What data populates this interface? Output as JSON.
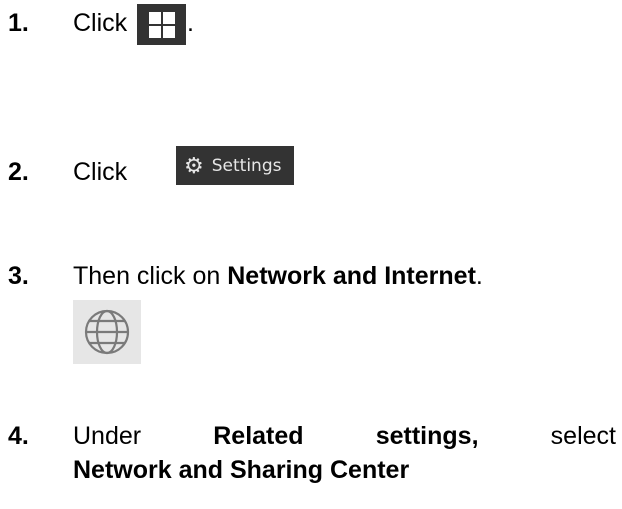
{
  "steps": [
    {
      "number": "1.",
      "prefix": "Click",
      "suffix": ".",
      "icon": "windows-start-icon"
    },
    {
      "number": "2.",
      "prefix": "Click",
      "button_label": "Settings",
      "icon": "gear-icon"
    },
    {
      "number": "3.",
      "prefix": "Then click on",
      "bold": "Network and Internet",
      "suffix": ".",
      "icon": "globe-icon"
    },
    {
      "number": "4.",
      "w1": "Under",
      "w2": "Related",
      "w3": "settings,",
      "w4": "select",
      "bold2": "Network and Sharing Center"
    }
  ],
  "colors": {
    "button_bg": "#333333",
    "tile_bg": "#e6e6e6",
    "icon_stroke": "#7a7a7a"
  }
}
